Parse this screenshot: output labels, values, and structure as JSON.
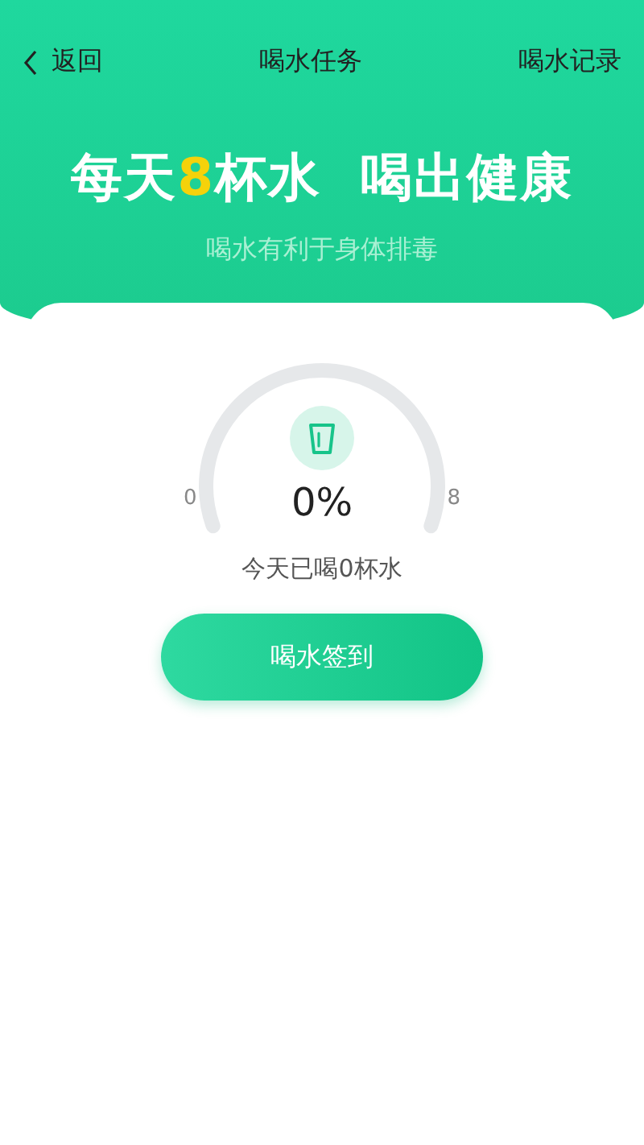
{
  "nav": {
    "back": "返回",
    "title": "喝水任务",
    "action": "喝水记录"
  },
  "banner": {
    "headline": [
      {
        "kind": "plain",
        "text": "每天"
      },
      {
        "kind": "highlight",
        "text": "8"
      },
      {
        "kind": "plain",
        "text": "杯水  喝出健康"
      }
    ],
    "subtitle": "喝水有利于身体排毒"
  },
  "gauge": {
    "min": "0",
    "max": "8",
    "percent": "0%"
  },
  "status": "今天已喝0杯水",
  "button": "喝水签到"
}
